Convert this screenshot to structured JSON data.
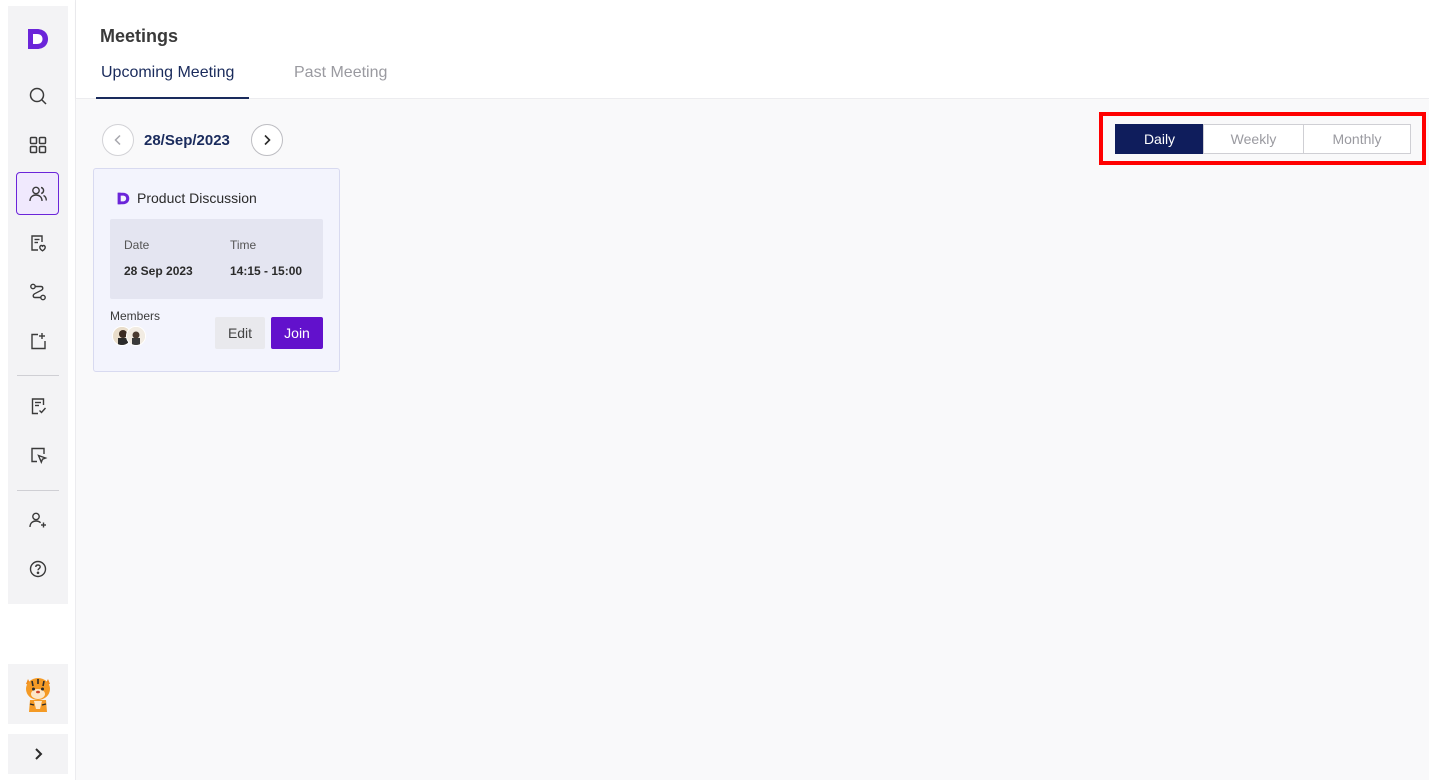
{
  "app": {
    "brand_icon": "brand-d-logo",
    "accent": "#6211cc",
    "navy": "#0f1d5c"
  },
  "sidebar": {
    "items": [
      {
        "icon": "search-icon"
      },
      {
        "icon": "grid-icon"
      },
      {
        "icon": "users-icon",
        "active": true
      },
      {
        "icon": "document-badge-icon"
      },
      {
        "icon": "route-icon"
      },
      {
        "icon": "add-page-icon"
      },
      {
        "icon": "checklist-icon"
      },
      {
        "icon": "cursor-doc-icon"
      },
      {
        "icon": "add-user-icon"
      },
      {
        "icon": "help-icon"
      }
    ],
    "avatar": "tiger-avatar",
    "expand_icon": "chevron-right-icon"
  },
  "header": {
    "title": "Meetings",
    "tabs": [
      {
        "label": "Upcoming Meeting",
        "active": true
      },
      {
        "label": "Past Meeting",
        "active": false
      }
    ]
  },
  "date_nav": {
    "current": "28/Sep/2023"
  },
  "view_toggle": {
    "options": [
      {
        "label": "Daily",
        "active": true
      },
      {
        "label": "Weekly",
        "active": false
      },
      {
        "label": "Monthly",
        "active": false
      }
    ],
    "highlight_color": "#ff0000"
  },
  "meetings": [
    {
      "title": "Product Discussion",
      "date_label": "Date",
      "date_value": "28 Sep 2023",
      "time_label": "Time",
      "time_value": "14:15 - 15:00",
      "members_label": "Members",
      "edit_label": "Edit",
      "join_label": "Join"
    }
  ]
}
